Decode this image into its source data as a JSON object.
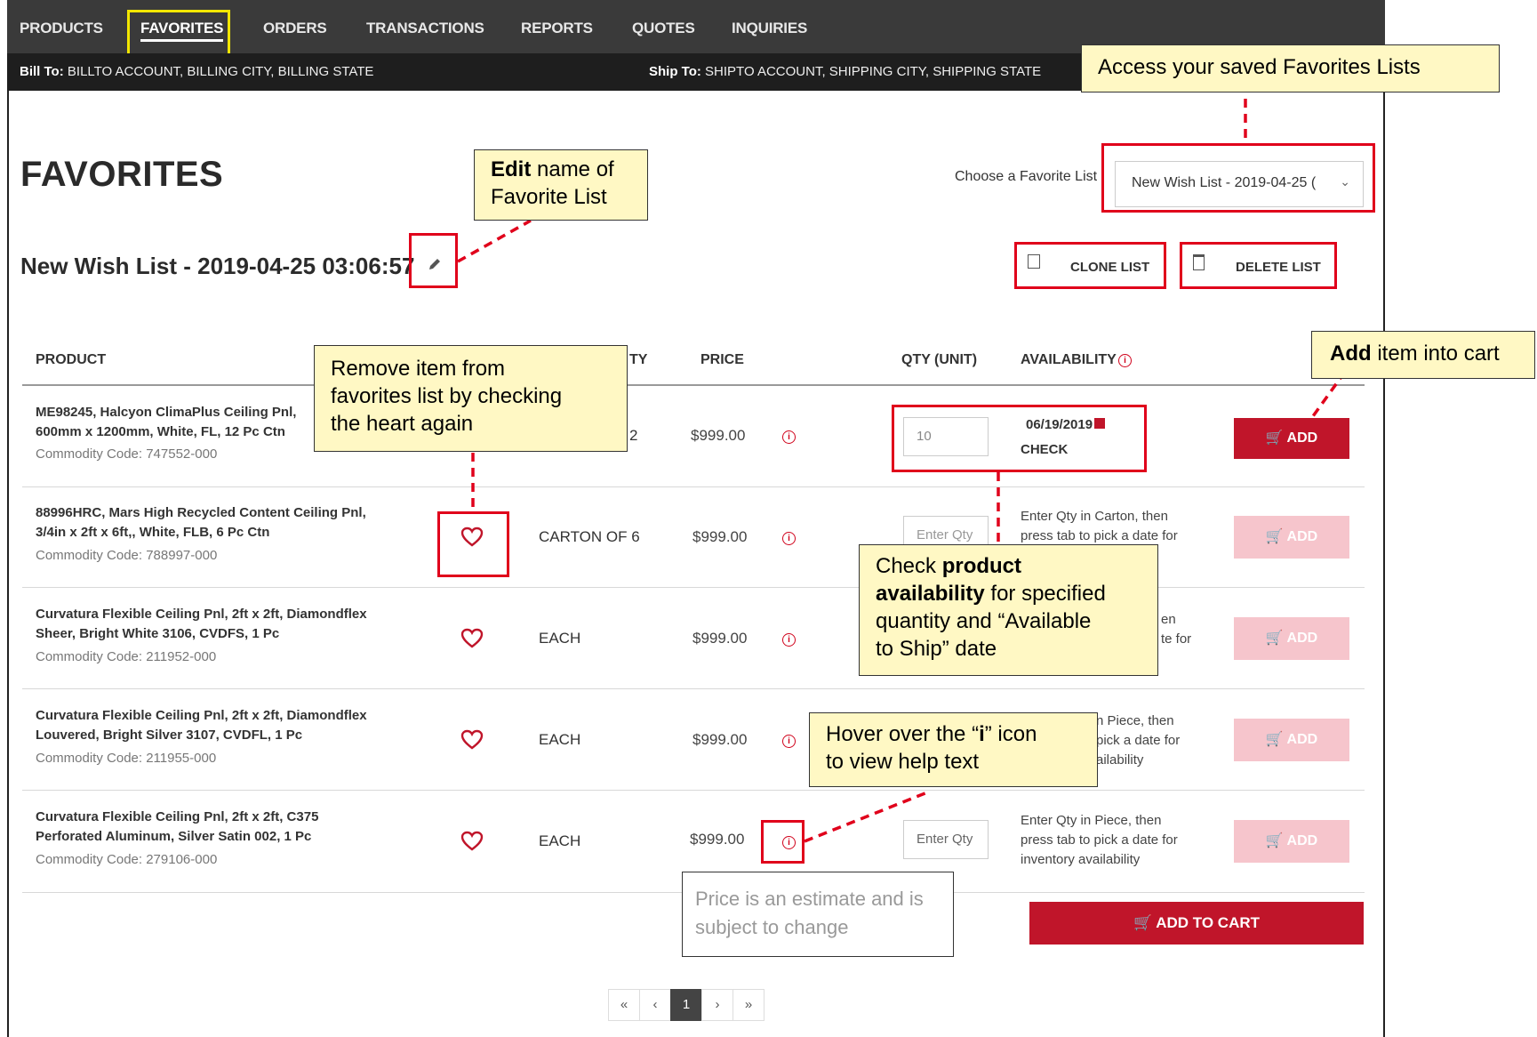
{
  "nav": {
    "items": [
      "PRODUCTS",
      "FAVORITES",
      "ORDERS",
      "TRANSACTIONS",
      "REPORTS",
      "QUOTES",
      "INQUIRIES"
    ],
    "active": "FAVORITES"
  },
  "billing": {
    "bill_label": "Bill To:",
    "bill_value": "BILLTO ACCOUNT, BILLING CITY, BILLING STATE",
    "ship_label": "Ship To:",
    "ship_value": "SHIPTO ACCOUNT, SHIPPING CITY, SHIPPING STATE"
  },
  "page": {
    "title": "FAVORITES",
    "list_name": "New Wish List - 2019-04-25 03:06:57",
    "choose_label": "Choose a Favorite List",
    "selected_list": "New Wish List - 2019-04-25 (",
    "clone_label": "CLONE LIST",
    "delete_label": "DELETE LIST"
  },
  "table": {
    "headers": {
      "product": "PRODUCT",
      "qty_partial": "TY",
      "price": "PRICE",
      "qty_unit": "QTY (UNIT)",
      "availability": "AVAILABILITY"
    },
    "rows": [
      {
        "name": "ME98245, Halcyon ClimaPlus Ceiling Pnl, 600mm x 1200mm, White, FL, 12 Pc Ctn",
        "name_l1": "ME98245, Halcyon ClimaPlus Ceiling Pnl,",
        "name_l2": "600mm x 1200mm, White, FL, 12 Pc Ctn",
        "code": "Commodity Code: 747552-000",
        "unit": "2",
        "price": "$999.00",
        "qty": "10",
        "avail_date": "06/19/2019",
        "avail_check": "CHECK",
        "add": "ADD"
      },
      {
        "name_l1": "88996HRC, Mars High Recycled Content Ceiling Pnl,",
        "name_l2": "3/4in x 2ft x 6ft,, White, FLB, 6 Pc Ctn",
        "code": "Commodity Code: 788997-000",
        "unit": "CARTON OF 6",
        "price": "$999.00",
        "qty_placeholder": "Enter Qty",
        "avail_l1": "Enter Qty in Carton, then",
        "avail_l2": "press tab to pick a date for",
        "add": "ADD"
      },
      {
        "name_l1": "Curvatura Flexible Ceiling Pnl, 2ft x 2ft, Diamondflex",
        "name_l2": "Sheer, Bright White 3106, CVDFS, 1 Pc",
        "code": "Commodity Code: 211952-000",
        "unit": "EACH",
        "price": "$999.00",
        "avail_l1": "en",
        "avail_l2": "te for",
        "add": "ADD"
      },
      {
        "name_l1": "Curvatura Flexible Ceiling Pnl, 2ft x 2ft, Diamondflex",
        "name_l2": "Louvered, Bright Silver 3107, CVDFL, 1 Pc",
        "code": "Commodity Code: 211955-000",
        "unit": "EACH",
        "price": "$999.00",
        "avail_l1": "n Piece, then",
        "avail_l2": "pick a date for",
        "avail_l3": "ailability",
        "add": "ADD"
      },
      {
        "name_l1": "Curvatura Flexible Ceiling Pnl, 2ft x 2ft, C375",
        "name_l2": "Perforated Aluminum, Silver Satin 002, 1 Pc",
        "code": "Commodity Code: 279106-000",
        "unit": "EACH",
        "price": "$999.00",
        "qty_placeholder": "Enter Qty",
        "avail_l1": "Enter Qty in Piece, then",
        "avail_l2": "press tab to pick a date for",
        "avail_l3": "inventory availability",
        "add": "ADD"
      }
    ],
    "add_to_cart": "ADD TO CART"
  },
  "tooltip": {
    "l1": "Price is an estimate and is",
    "l2": "subject to change"
  },
  "pager": {
    "first": "«",
    "prev": "‹",
    "current": "1",
    "next": "›",
    "last": "»"
  },
  "callouts": {
    "favorites_lists": "Access your saved Favorites Lists",
    "edit_bold": "Edit",
    "edit_rest1": " name of",
    "edit_rest2": "Favorite List",
    "remove_l1": "Remove item from",
    "remove_l2": "favorites list by checking",
    "remove_l3": "the heart again",
    "add_bold": "Add",
    "add_rest": " item into cart",
    "check_l1a": "Check ",
    "check_l1b": "product",
    "check_l2a": "availability",
    "check_l2b": " for specified",
    "check_l3": "quantity and “Available",
    "check_l4": "to Ship” date",
    "hover_l1a": "Hover over the “",
    "hover_l1b": "i",
    "hover_l1c": "” icon",
    "hover_l2": "to view help text"
  },
  "colors": {
    "accent_red": "#c0152a",
    "annotation_red": "#e0001b",
    "callout_bg": "#fff8c4",
    "nav_bg": "#3a3a3a"
  }
}
